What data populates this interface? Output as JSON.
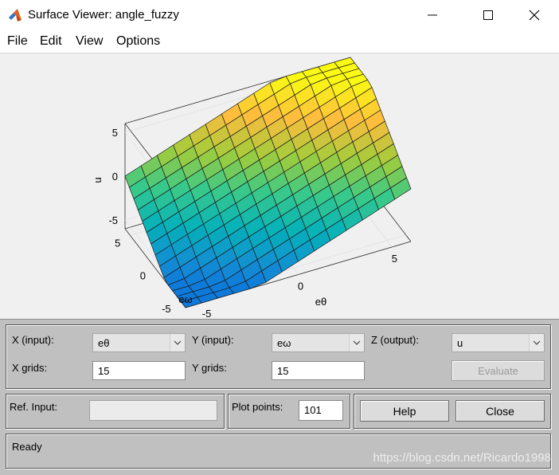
{
  "window": {
    "title": "Surface Viewer: angle_fuzzy",
    "icon": "matlab-icon"
  },
  "menu": [
    "File",
    "Edit",
    "View",
    "Options"
  ],
  "plot": {
    "zlabel": "u",
    "xlabel": "eθ",
    "ylabel": "eω",
    "z_ticks": [
      "5",
      "0",
      "-5"
    ],
    "y_ticks": [
      "5",
      "0",
      "-5"
    ],
    "x_ticks": [
      "-5",
      "0",
      "5"
    ],
    "x_range": [
      -6,
      6
    ],
    "y_range": [
      -6,
      6
    ],
    "z_range": [
      -6,
      6
    ],
    "grid_points": 15,
    "colormap": "parula"
  },
  "controls": {
    "x_input_label": "X (input):",
    "x_input_value": "eθ",
    "y_input_label": "Y (input):",
    "y_input_value": "eω",
    "z_output_label": "Z (output):",
    "z_output_value": "u",
    "x_grids_label": "X grids:",
    "x_grids_value": "15",
    "y_grids_label": "Y grids:",
    "y_grids_value": "15",
    "evaluate_label": "Evaluate",
    "ref_input_label": "Ref. Input:",
    "ref_input_value": "",
    "plot_points_label": "Plot points:",
    "plot_points_value": "101",
    "help_label": "Help",
    "close_label": "Close"
  },
  "status": "Ready",
  "watermark": "https://blog.csdn.net/Ricardo1998"
}
